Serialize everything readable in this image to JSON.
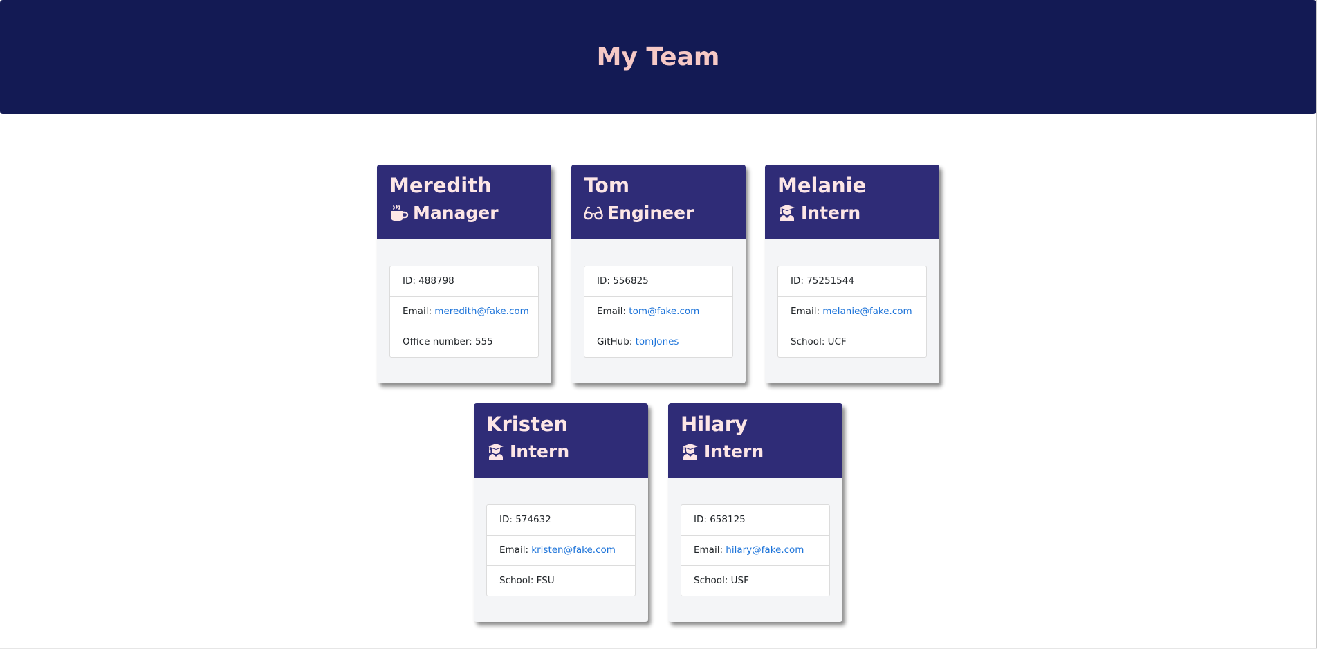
{
  "header": {
    "title": "My Team"
  },
  "cards": [
    {
      "name": "Meredith",
      "role": "Manager",
      "role_icon": "coffee-mug-icon",
      "id_label": "ID: ",
      "id": "488798",
      "email_label": "Email: ",
      "email": "meredith@fake.com",
      "extra_label": "Office number: ",
      "extra_value": "555"
    },
    {
      "name": "Tom",
      "role": "Engineer",
      "role_icon": "glasses-icon",
      "id_label": "ID: ",
      "id": "556825",
      "email_label": "Email: ",
      "email": "tom@fake.com",
      "extra_label": "GitHub: ",
      "extra_value": "tomJones"
    },
    {
      "name": "Melanie",
      "role": "Intern",
      "role_icon": "graduate-icon",
      "id_label": "ID: ",
      "id": "75251544",
      "email_label": "Email: ",
      "email": "melanie@fake.com",
      "extra_label": "School: ",
      "extra_value": "UCF"
    },
    {
      "name": "Kristen",
      "role": "Intern",
      "role_icon": "graduate-icon",
      "id_label": "ID: ",
      "id": "574632",
      "email_label": "Email: ",
      "email": "kristen@fake.com",
      "extra_label": "School: ",
      "extra_value": "FSU"
    },
    {
      "name": "Hilary",
      "role": "Intern",
      "role_icon": "graduate-icon",
      "id_label": "ID: ",
      "id": "658125",
      "email_label": "Email: ",
      "email": "hilary@fake.com",
      "extra_label": "School: ",
      "extra_value": "USF"
    }
  ],
  "colors": {
    "header_bg": "#131a54",
    "header_text": "#f6c9c6",
    "card_header_bg": "#2f2c77",
    "card_header_text": "#fde6e6",
    "link": "#1c73d9"
  }
}
